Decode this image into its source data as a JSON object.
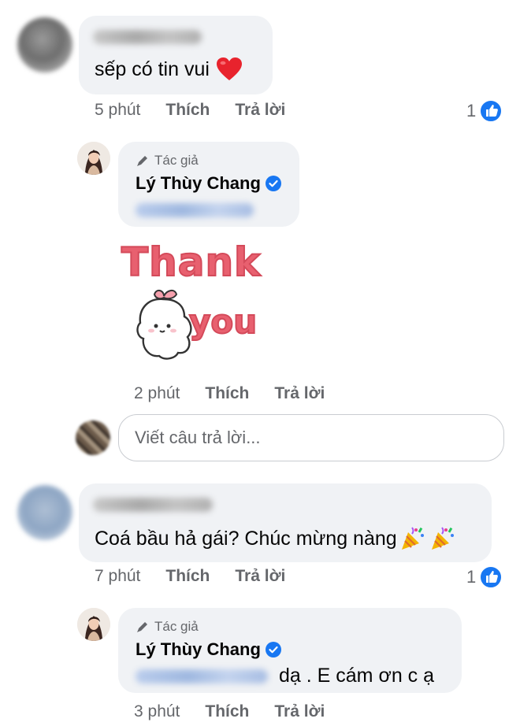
{
  "comments": [
    {
      "text": "sếp có tin vui",
      "time": "5 phút",
      "like_label": "Thích",
      "reply_label": "Trả lời",
      "reactions": "1"
    },
    {
      "text": "Coá bầu hả gái? Chúc mừng nàng",
      "time": "7 phút",
      "like_label": "Thích",
      "reply_label": "Trả lời",
      "reactions": "1"
    }
  ],
  "replies": [
    {
      "author_tag": "Tác giả",
      "author": "Lý Thùy Chang",
      "sticker_line1": "Thank",
      "sticker_line2": "you",
      "time": "2 phút",
      "like_label": "Thích",
      "reply_label": "Trả lời"
    },
    {
      "author_tag": "Tác giả",
      "author": "Lý Thùy Chang",
      "text": "dạ . E cám ơn c ạ",
      "time": "3 phút",
      "like_label": "Thích",
      "reply_label": "Trả lời"
    }
  ],
  "reply_box": {
    "placeholder": "Viết câu trả lời..."
  },
  "colors": {
    "bubble": "#f0f2f5",
    "meta_text": "#65676b",
    "facebook_blue": "#1877f2",
    "sticker_pink": "#e8606f"
  },
  "icons": {
    "heart": "heart-emoji-icon",
    "party": "party-popper-emoji-icon",
    "verified": "verified-badge-icon",
    "pen": "pen-icon",
    "like": "like-thumb-icon"
  }
}
